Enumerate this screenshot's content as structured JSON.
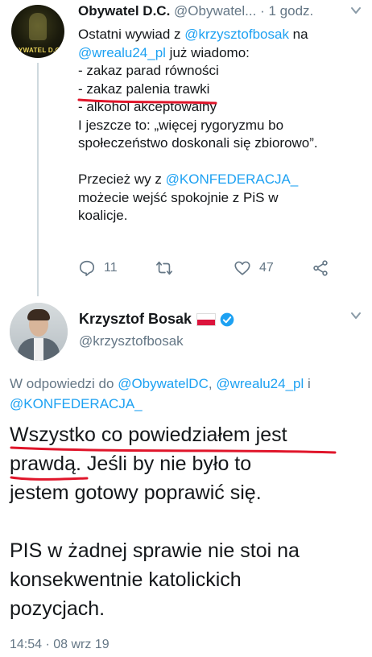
{
  "tweet1": {
    "author_name": "Obywatel D.C.",
    "handle": "@Obywatel...",
    "separator": "·",
    "time": "1 godz.",
    "avatar_text": "BYWATEL D.C.",
    "text_lines": [
      {
        "parts": [
          {
            "t": "Ostatni wywiad z "
          },
          {
            "t": "@krzysztofbosak",
            "link": true
          },
          {
            "t": " na"
          }
        ]
      },
      {
        "parts": [
          {
            "t": "@wrealu24_pl",
            "link": true
          },
          {
            "t": " już wiadomo:"
          }
        ]
      },
      {
        "parts": [
          {
            "t": "- zakaz parad równości"
          }
        ]
      },
      {
        "parts": [
          {
            "t": "- zakaz palenia trawki"
          }
        ]
      },
      {
        "parts": [
          {
            "t": "- alkohol akceptowalny"
          }
        ]
      },
      {
        "parts": [
          {
            "t": "I jeszcze to: „więcej rygoryzmu bo"
          }
        ]
      },
      {
        "parts": [
          {
            "t": "społeczeństwo doskonali się zbiorowo”."
          }
        ]
      },
      {
        "parts": [
          {
            "t": ""
          }
        ]
      },
      {
        "parts": [
          {
            "t": "Przecież wy z "
          },
          {
            "t": "@KONFEDERACJA_",
            "link": true
          }
        ]
      },
      {
        "parts": [
          {
            "t": "możecie wejść spokojnie z PiS w"
          }
        ]
      },
      {
        "parts": [
          {
            "t": "koalicje."
          }
        ]
      }
    ],
    "actions": {
      "reply_count": "11",
      "retweet_count": "",
      "like_count": "47"
    }
  },
  "tweet2": {
    "author_name": "Krzysztof Bosak",
    "handle": "@krzysztofbosak",
    "reply_prefix": "W odpowiedzi do ",
    "reply_handles": [
      "@ObywatelDC",
      "@wrealu24_pl",
      "@KONFEDERACJA_"
    ],
    "reply_sep1": ", ",
    "reply_sep2": " i",
    "text_lines": [
      "Wszystko co powiedziałem jest",
      "prawdą. Jeśli by nie było to",
      "jestem gotowy poprawić się.",
      "",
      "PIS w żadnej sprawie nie stoi na",
      "konsekwentnie katolickich",
      "pozycjach."
    ],
    "timestamp": "14:54 · 08 wrz 19"
  },
  "colors": {
    "link": "#1da1f2",
    "muted": "#657786",
    "annotation": "#e0162b",
    "verified": "#1da1f2"
  }
}
